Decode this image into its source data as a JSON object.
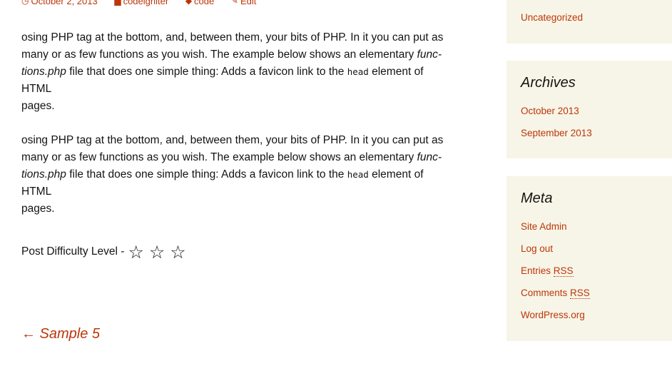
{
  "meta": {
    "date": "October 2, 2013",
    "category": "codeigniter",
    "tag": "code",
    "edit": "Edit"
  },
  "paragraphs": [
    {
      "line1": "osing PHP tag at the bottom, and, between them, your bits of PHP. In it you can put as",
      "line2_pre": "many or as few functions as you wish. The example below shows an elementary ",
      "line2_em": "func-",
      "line3_em": "tions.php",
      "line3_mid": " file that does one simple thing: Adds a favicon link to the ",
      "line3_code": "head",
      "line3_post": " element of HTML",
      "line4": "pages."
    },
    {
      "line1": "osing PHP tag at the bottom, and, between them, your bits of PHP. In it you can put as",
      "line2_pre": "many or as few functions as you wish. The example below shows an elementary ",
      "line2_em": "func-",
      "line3_em": "tions.php",
      "line3_mid": " file that does one simple thing: Adds a favicon link to the ",
      "line3_code": "head",
      "line3_post": " element of HTML",
      "line4": "pages."
    }
  ],
  "difficulty": {
    "label": "Post Difficulty Level - ",
    "stars": [
      "☆",
      "☆",
      "☆"
    ]
  },
  "prev_post": "← Sample 5",
  "sidebar": {
    "categories_last": "Uncategorized",
    "archives": {
      "title": "Archives",
      "items": [
        "October 2013",
        "September 2013"
      ]
    },
    "meta": {
      "title": "Meta",
      "site_admin": "Site Admin",
      "log_out": "Log out",
      "entries": "Entries ",
      "entries_rss": "RSS",
      "comments": "Comments ",
      "comments_rss": "RSS",
      "wordpress": "WordPress.org"
    }
  },
  "colors": {
    "link": "#bc360a",
    "sidebar_bg": "#f7f5e7",
    "text": "#141412"
  }
}
